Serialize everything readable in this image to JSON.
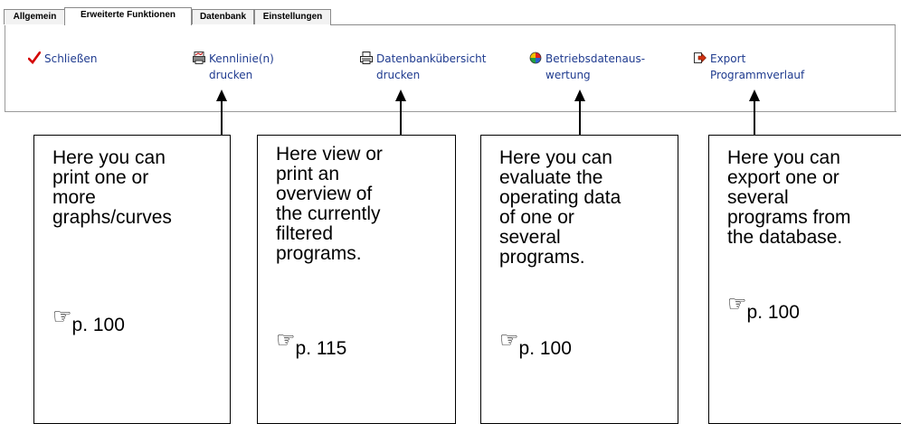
{
  "tabs": [
    {
      "label": "Allgemein",
      "active": false
    },
    {
      "label": "Erweiterte Funktionen",
      "active": true
    },
    {
      "label": "Datenbank",
      "active": false
    },
    {
      "label": "Einstellungen",
      "active": false
    }
  ],
  "commands": [
    {
      "label_line1": "Schließen",
      "label_line2": "",
      "icon": "checkmark-icon"
    },
    {
      "label_line1": "Kennlinie(n)",
      "label_line2": "drucken",
      "icon": "print-graph-icon"
    },
    {
      "label_line1": "Datenbankübersicht",
      "label_line2": "drucken",
      "icon": "printer-icon"
    },
    {
      "label_line1": "Betriebsdatenaus-",
      "label_line2": "wertung",
      "icon": "pie-chart-icon"
    },
    {
      "label_line1": "Export",
      "label_line2": "Programmverlauf",
      "icon": "export-icon"
    }
  ],
  "callouts": [
    {
      "text": "Here you can\nprint one or\nmore\ngraphs/curves",
      "ref": "p. 100"
    },
    {
      "text": "Here view  or\nprint an\noverview of\nthe currently\nfiltered\nprograms.",
      "ref": "p. 115"
    },
    {
      "text": "Here you can\nevaluate the\noperating data\nof one or\nseveral\nprograms.",
      "ref": "p. 100"
    },
    {
      "text": "Here you can\nexport one or\nseveral\nprograms from\nthe database.",
      "ref": "p. 100"
    }
  ],
  "reference_symbol": "☞"
}
